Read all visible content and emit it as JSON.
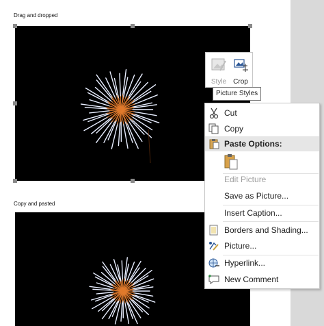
{
  "document": {
    "caption_1": "Drag and dropped",
    "caption_2": "Copy and pasted"
  },
  "mini_toolbar": {
    "style_label": "Style",
    "crop_label": "Crop",
    "tooltip": "Picture Styles"
  },
  "context_menu": {
    "cut": "Cut",
    "copy": "Copy",
    "paste_options": "Paste Options:",
    "edit_picture": "Edit Picture",
    "save_as_picture": "Save as Picture...",
    "insert_caption": "Insert Caption...",
    "borders_and_shading": "Borders and Shading...",
    "picture": "Picture...",
    "hyperlink": "Hyperlink...",
    "new_comment": "New Comment"
  },
  "colors": {
    "selection_handle": "#8a8a8a",
    "firework_white": "#e8eeff",
    "firework_orange": "#e07a2c"
  }
}
